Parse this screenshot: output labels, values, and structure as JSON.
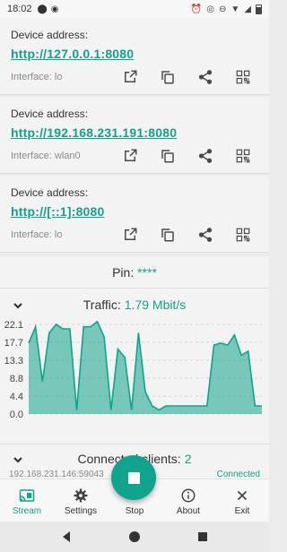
{
  "status_bar": {
    "time": "18:02"
  },
  "devices": [
    {
      "label": "Device address:",
      "address": "http://127.0.0.1:8080",
      "interface": "Interface: lo"
    },
    {
      "label": "Device address:",
      "address": "http://192.168.231.191:8080",
      "interface": "Interface: wlan0"
    },
    {
      "label": "Device address:",
      "address": "http://[::1]:8080",
      "interface": "Interface: lo"
    }
  ],
  "pin": {
    "label": "Pin:",
    "value": "****"
  },
  "traffic": {
    "label": "Traffic:",
    "value": "1.79 Mbit/s"
  },
  "clients": {
    "label": "Connected clients:",
    "count": "2",
    "first_client_address": "192.168.231.146:59043",
    "first_client_status": "Connected"
  },
  "nav": [
    {
      "label": "Stream",
      "icon": "cast-icon",
      "active": true
    },
    {
      "label": "Settings",
      "icon": "gear-icon"
    },
    {
      "label": "Stop",
      "icon": "stop-icon"
    },
    {
      "label": "About",
      "icon": "info-icon"
    },
    {
      "label": "Exit",
      "icon": "close-icon"
    }
  ],
  "chart_data": {
    "type": "area",
    "title": "",
    "xlabel": "",
    "ylabel": "",
    "yticks": [
      "22.1",
      "17.7",
      "13.3",
      "8.8",
      "4.4",
      "0.0"
    ],
    "ylim": [
      0,
      22.1
    ],
    "grid": true,
    "color": "#10a38d",
    "values": [
      17.5,
      21.5,
      8,
      20,
      22.1,
      21,
      21,
      1,
      21.5,
      21.5,
      22.8,
      19,
      1,
      16,
      14,
      1,
      20,
      5.5,
      2,
      1,
      2,
      2,
      2,
      2,
      2,
      2,
      2,
      17,
      17.5,
      17,
      19.5,
      14.5,
      15.5,
      2,
      2
    ]
  }
}
